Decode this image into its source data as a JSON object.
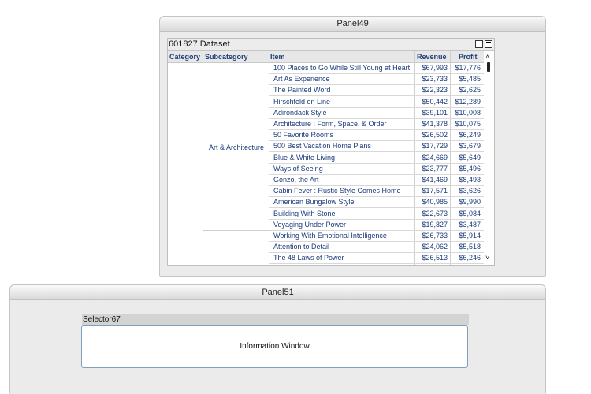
{
  "panel49": {
    "title": "Panel49"
  },
  "dataset": {
    "title": "601827 Dataset",
    "columns": [
      "Category",
      "Subcategory",
      "Item",
      "Revenue",
      "Profit"
    ],
    "subcategory": "Art & Architecture",
    "rows": [
      {
        "item": "100 Places to Go While Still Young at Heart",
        "revenue": "$67,993",
        "profit": "$17,776"
      },
      {
        "item": "Art As Experience",
        "revenue": "$23,733",
        "profit": "$5,485"
      },
      {
        "item": "The Painted Word",
        "revenue": "$22,323",
        "profit": "$2,625"
      },
      {
        "item": "Hirschfeld on Line",
        "revenue": "$50,442",
        "profit": "$12,289"
      },
      {
        "item": "Adirondack Style",
        "revenue": "$39,101",
        "profit": "$10,008"
      },
      {
        "item": "Architecture : Form, Space, & Order",
        "revenue": "$41,378",
        "profit": "$10,075"
      },
      {
        "item": "50 Favorite Rooms",
        "revenue": "$26,502",
        "profit": "$6,249"
      },
      {
        "item": "500 Best Vacation Home Plans",
        "revenue": "$17,729",
        "profit": "$3,679"
      },
      {
        "item": "Blue & White Living",
        "revenue": "$24,669",
        "profit": "$5,649"
      },
      {
        "item": "Ways of Seeing",
        "revenue": "$23,777",
        "profit": "$5,496"
      },
      {
        "item": "Gonzo, the Art",
        "revenue": "$41,469",
        "profit": "$8,493"
      },
      {
        "item": "Cabin Fever : Rustic Style Comes Home",
        "revenue": "$17,571",
        "profit": "$3,626"
      },
      {
        "item": "American Bungalow Style",
        "revenue": "$40,985",
        "profit": "$9,990"
      },
      {
        "item": "Building With Stone",
        "revenue": "$22,673",
        "profit": "$5,084"
      },
      {
        "item": "Voyaging Under Power",
        "revenue": "$19,827",
        "profit": "$3,487"
      },
      {
        "item": "Working With Emotional Intelligence",
        "revenue": "$26,733",
        "profit": "$5,914"
      },
      {
        "item": "Attention to Detail",
        "revenue": "$24,062",
        "profit": "$5,518"
      },
      {
        "item": "The 48 Laws of Power",
        "revenue": "$26,513",
        "profit": "$6,246"
      }
    ]
  },
  "panel51": {
    "title": "Panel51"
  },
  "selector": {
    "title": "Selector67",
    "info_text": "Information Window"
  },
  "icons": {
    "minimize": "minimize-icon",
    "maximize": "maximize-icon",
    "scroll_up": "chevron-up-icon",
    "scroll_down": "chevron-down-icon"
  }
}
